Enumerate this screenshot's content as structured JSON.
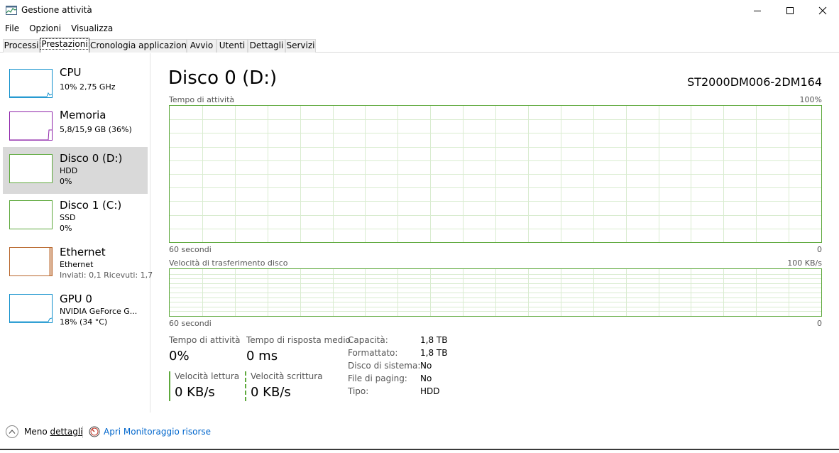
{
  "window": {
    "title": "Gestione attività",
    "accent": "#5ea93d"
  },
  "menu": [
    "File",
    "Opzioni",
    "Visualizza"
  ],
  "tabs": [
    "Processi",
    "Prestazioni",
    "Cronologia applicazioni",
    "Avvio",
    "Utenti",
    "Dettagli",
    "Servizi"
  ],
  "active_tab": "Prestazioni",
  "sidebar": {
    "items": [
      {
        "name": "CPU",
        "line1": "10% 2,75 GHz",
        "line2": "",
        "color": "#1190cc"
      },
      {
        "name": "Memoria",
        "line1": "5,8/15,9 GB (36%)",
        "line2": "",
        "color": "#8e24aa"
      },
      {
        "name": "Disco 0 (D:)",
        "line1": "HDD",
        "line2": "0%",
        "color": "#5ea93d"
      },
      {
        "name": "Disco 1 (C:)",
        "line1": "SSD",
        "line2": "0%",
        "color": "#5ea93d"
      },
      {
        "name": "Ethernet",
        "line1": "Ethernet",
        "line2": "Inviati: 0,1 Ricevuti: 1,7",
        "color": "#b8652a"
      },
      {
        "name": "GPU 0",
        "line1": "NVIDIA GeForce G...",
        "line2": "18% (34 °C)",
        "color": "#1190cc"
      }
    ]
  },
  "main": {
    "title": "Disco 0 (D:)",
    "model": "ST2000DM006-2DM164",
    "graph1": {
      "label": "Tempo di attività",
      "max": "100%",
      "time": "60 secondi",
      "min": "0"
    },
    "graph2": {
      "label": "Velocità di trasferimento disco",
      "max": "100 KB/s",
      "time": "60 secondi",
      "min": "0"
    },
    "stats": {
      "active_label": "Tempo di attività",
      "active_value": "0%",
      "response_label": "Tempo di risposta medio",
      "response_value": "0 ms",
      "read_label": "Velocità lettura",
      "read_value": "0 KB/s",
      "write_label": "Velocità scrittura",
      "write_value": "0 KB/s"
    },
    "properties": [
      {
        "key": "Capacità:",
        "value": "1,8 TB"
      },
      {
        "key": "Formattato:",
        "value": "1,8 TB"
      },
      {
        "key": "Disco di sistema:",
        "value": "No"
      },
      {
        "key": "File di paging:",
        "value": "No"
      },
      {
        "key": "Tipo:",
        "value": "HDD"
      }
    ]
  },
  "footer": {
    "fewer_details_prefix": "Meno ",
    "fewer_details_underlined": "dettagli",
    "resource_monitor": "Apri Monitoraggio risorse"
  }
}
